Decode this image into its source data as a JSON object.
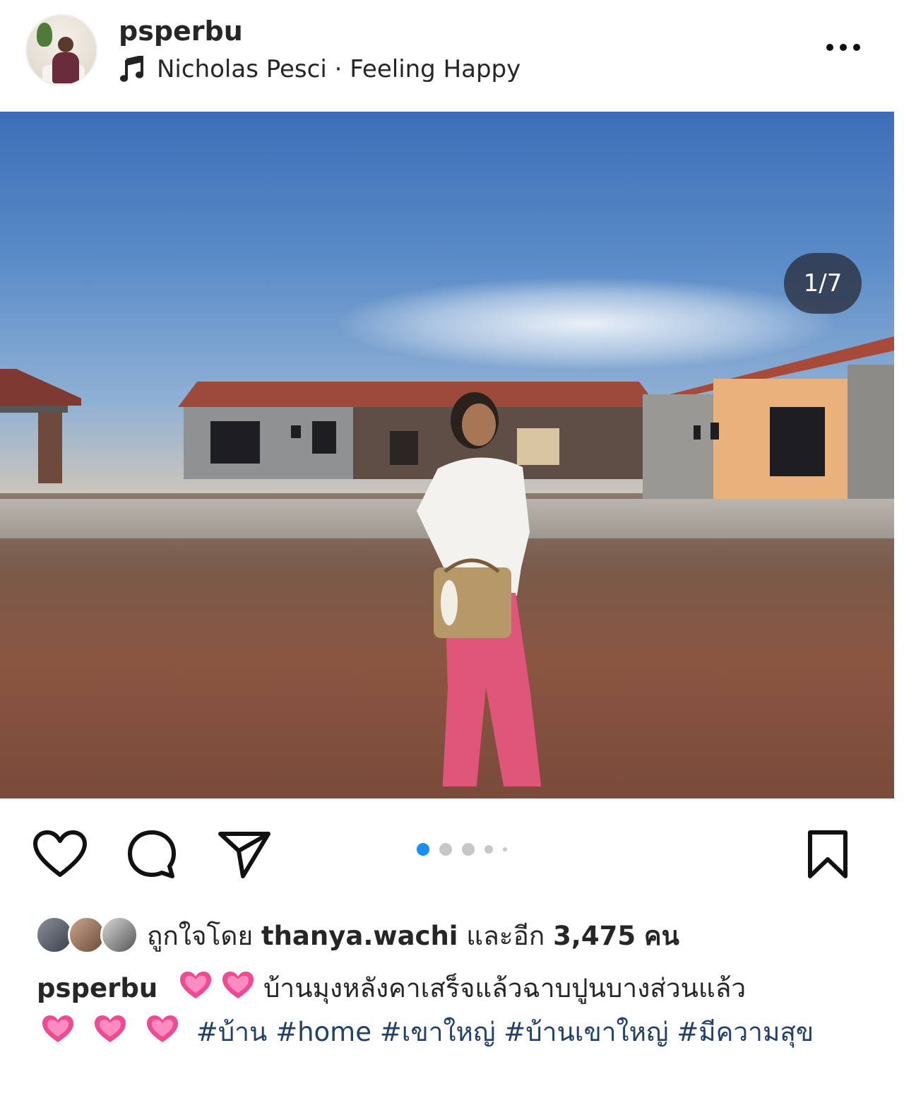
{
  "post": {
    "username": "psperbu",
    "music": "Nicholas Pesci · Feeling Happy",
    "slide_counter": "1/7",
    "carousel_dots": 5,
    "active_dot": 0
  },
  "likes": {
    "prefix": "ถูกใจโดย",
    "user": "thanya.wachi",
    "middle": "และอีก",
    "count": "3,475",
    "suffix": "คน"
  },
  "caption": {
    "username": "psperbu",
    "text": "บ้านมุงหลังคาเสร็จแล้วฉาบปูนบางส่วนแล้ว",
    "hashtags": [
      "#บ้าน",
      "#home",
      "#เขาใหญ่",
      "#บ้านเขาใหญ่",
      "#มีความสุข"
    ]
  },
  "icons": {
    "more": "more-horizontal-icon",
    "music": "music-note-icon",
    "like": "heart-outline-icon",
    "comment": "comment-bubble-icon",
    "share": "paper-plane-icon",
    "save": "bookmark-outline-icon",
    "tag": "person-tag-icon",
    "sound": "speaker-icon",
    "emoji": "growing-heart-emoji"
  },
  "colors": {
    "text": "#262626",
    "active_dot": "#1a8ff0",
    "inactive_dot": "#c7c7c7",
    "hashtag": "#23406b"
  }
}
